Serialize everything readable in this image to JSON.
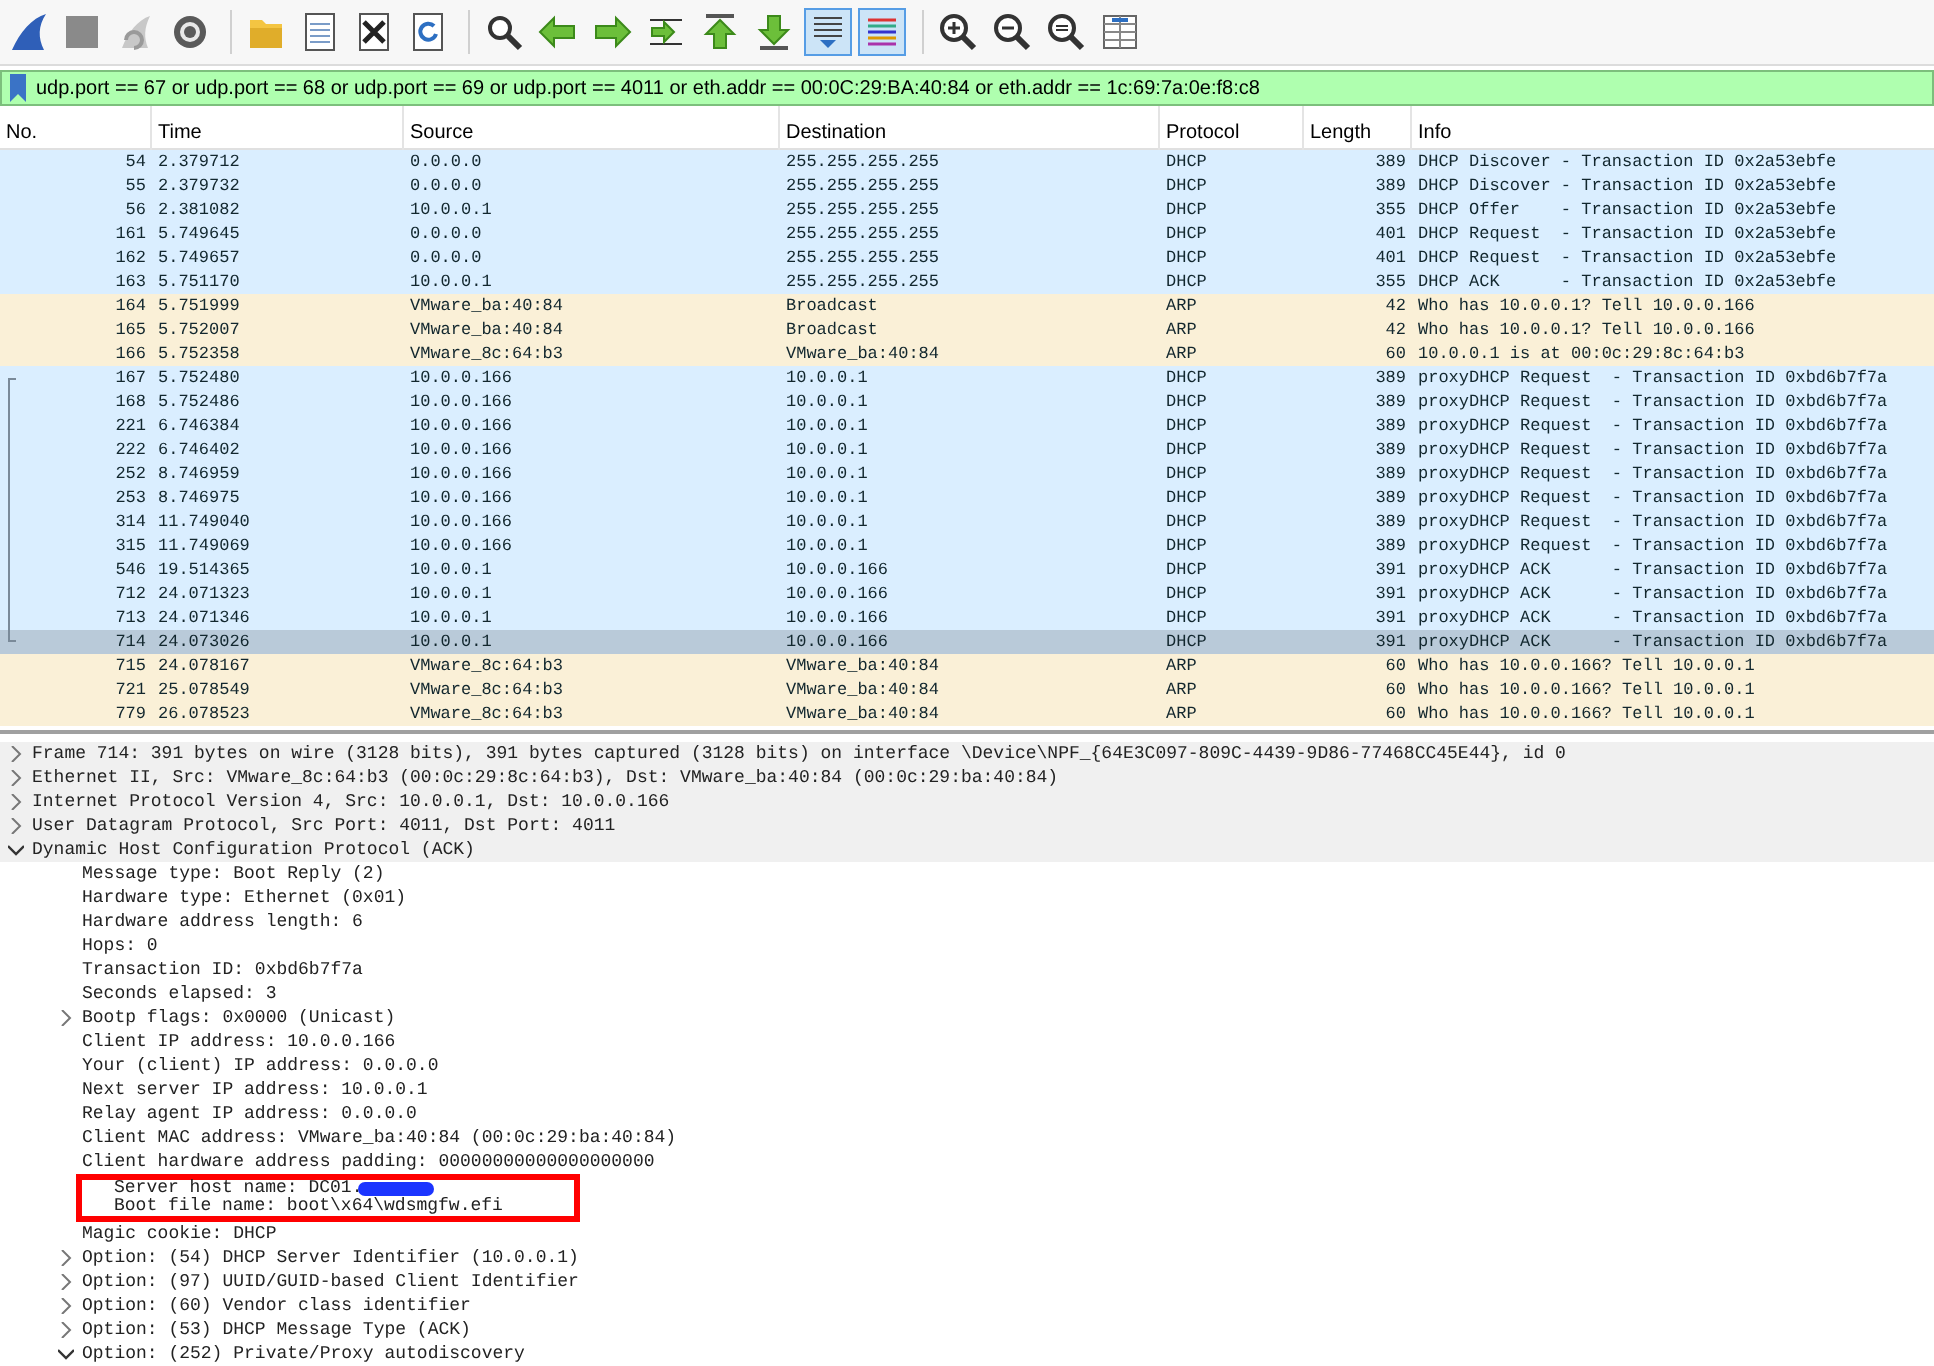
{
  "toolbar": {
    "groups": [
      [
        {
          "kind": "fin",
          "pressed": false
        },
        {
          "kind": "stop",
          "pressed": false
        },
        {
          "kind": "restart",
          "pressed": false
        },
        {
          "kind": "options",
          "pressed": false
        }
      ],
      [
        {
          "kind": "open",
          "pressed": false
        },
        {
          "kind": "file",
          "pressed": false
        },
        {
          "kind": "close",
          "pressed": false
        },
        {
          "kind": "reload",
          "pressed": false
        }
      ],
      [
        {
          "kind": "find",
          "pressed": false
        },
        {
          "kind": "back",
          "pressed": false
        },
        {
          "kind": "forward",
          "pressed": false
        },
        {
          "kind": "goto",
          "pressed": false
        },
        {
          "kind": "first",
          "pressed": false
        },
        {
          "kind": "last",
          "pressed": false
        },
        {
          "kind": "autoscroll",
          "pressed": true
        },
        {
          "kind": "colorize",
          "pressed": true
        }
      ],
      [
        {
          "kind": "zoom-in",
          "pressed": false
        },
        {
          "kind": "zoom-out",
          "pressed": false
        },
        {
          "kind": "zoom-normal",
          "pressed": false
        },
        {
          "kind": "resize",
          "pressed": false
        }
      ]
    ]
  },
  "display_filter": {
    "value": "udp.port == 67 or udp.port == 68 or udp.port == 69 or udp.port == 4011 or eth.addr == 00:0C:29:BA:40:84 or eth.addr == 1c:69:7a:0e:f8:c8"
  },
  "packet_list": {
    "columns": [
      "No.",
      "Time",
      "Source",
      "Destination",
      "Protocol",
      "Length",
      "Info"
    ],
    "rows": [
      {
        "no": "54",
        "time": "2.379712",
        "source": "0.0.0.0",
        "destination": "255.255.255.255",
        "protocol": "DHCP",
        "length": "389",
        "info": "DHCP Discover - Transaction ID 0x2a53ebfe",
        "color": "#daeeff",
        "selected": false,
        "related": false
      },
      {
        "no": "55",
        "time": "2.379732",
        "source": "0.0.0.0",
        "destination": "255.255.255.255",
        "protocol": "DHCP",
        "length": "389",
        "info": "DHCP Discover - Transaction ID 0x2a53ebfe",
        "color": "#daeeff",
        "selected": false,
        "related": false
      },
      {
        "no": "56",
        "time": "2.381082",
        "source": "10.0.0.1",
        "destination": "255.255.255.255",
        "protocol": "DHCP",
        "length": "355",
        "info": "DHCP Offer    - Transaction ID 0x2a53ebfe",
        "color": "#daeeff",
        "selected": false,
        "related": false
      },
      {
        "no": "161",
        "time": "5.749645",
        "source": "0.0.0.0",
        "destination": "255.255.255.255",
        "protocol": "DHCP",
        "length": "401",
        "info": "DHCP Request  - Transaction ID 0x2a53ebfe",
        "color": "#daeeff",
        "selected": false,
        "related": false
      },
      {
        "no": "162",
        "time": "5.749657",
        "source": "0.0.0.0",
        "destination": "255.255.255.255",
        "protocol": "DHCP",
        "length": "401",
        "info": "DHCP Request  - Transaction ID 0x2a53ebfe",
        "color": "#daeeff",
        "selected": false,
        "related": false
      },
      {
        "no": "163",
        "time": "5.751170",
        "source": "10.0.0.1",
        "destination": "255.255.255.255",
        "protocol": "DHCP",
        "length": "355",
        "info": "DHCP ACK      - Transaction ID 0x2a53ebfe",
        "color": "#daeeff",
        "selected": false,
        "related": false
      },
      {
        "no": "164",
        "time": "5.751999",
        "source": "VMware_ba:40:84",
        "destination": "Broadcast",
        "protocol": "ARP",
        "length": "42",
        "info": "Who has 10.0.0.1? Tell 10.0.0.166",
        "color": "#faf0d7",
        "selected": false,
        "related": false
      },
      {
        "no": "165",
        "time": "5.752007",
        "source": "VMware_ba:40:84",
        "destination": "Broadcast",
        "protocol": "ARP",
        "length": "42",
        "info": "Who has 10.0.0.1? Tell 10.0.0.166",
        "color": "#faf0d7",
        "selected": false,
        "related": false
      },
      {
        "no": "166",
        "time": "5.752358",
        "source": "VMware_8c:64:b3",
        "destination": "VMware_ba:40:84",
        "protocol": "ARP",
        "length": "60",
        "info": "10.0.0.1 is at 00:0c:29:8c:64:b3",
        "color": "#faf0d7",
        "selected": false,
        "related": false
      },
      {
        "no": "167",
        "time": "5.752480",
        "source": "10.0.0.166",
        "destination": "10.0.0.1",
        "protocol": "DHCP",
        "length": "389",
        "info": "proxyDHCP Request  - Transaction ID 0xbd6b7f7a",
        "color": "#daeeff",
        "selected": false,
        "related": true
      },
      {
        "no": "168",
        "time": "5.752486",
        "source": "10.0.0.166",
        "destination": "10.0.0.1",
        "protocol": "DHCP",
        "length": "389",
        "info": "proxyDHCP Request  - Transaction ID 0xbd6b7f7a",
        "color": "#daeeff",
        "selected": false,
        "related": true
      },
      {
        "no": "221",
        "time": "6.746384",
        "source": "10.0.0.166",
        "destination": "10.0.0.1",
        "protocol": "DHCP",
        "length": "389",
        "info": "proxyDHCP Request  - Transaction ID 0xbd6b7f7a",
        "color": "#daeeff",
        "selected": false,
        "related": true
      },
      {
        "no": "222",
        "time": "6.746402",
        "source": "10.0.0.166",
        "destination": "10.0.0.1",
        "protocol": "DHCP",
        "length": "389",
        "info": "proxyDHCP Request  - Transaction ID 0xbd6b7f7a",
        "color": "#daeeff",
        "selected": false,
        "related": true
      },
      {
        "no": "252",
        "time": "8.746959",
        "source": "10.0.0.166",
        "destination": "10.0.0.1",
        "protocol": "DHCP",
        "length": "389",
        "info": "proxyDHCP Request  - Transaction ID 0xbd6b7f7a",
        "color": "#daeeff",
        "selected": false,
        "related": true
      },
      {
        "no": "253",
        "time": "8.746975",
        "source": "10.0.0.166",
        "destination": "10.0.0.1",
        "protocol": "DHCP",
        "length": "389",
        "info": "proxyDHCP Request  - Transaction ID 0xbd6b7f7a",
        "color": "#daeeff",
        "selected": false,
        "related": true
      },
      {
        "no": "314",
        "time": "11.749040",
        "source": "10.0.0.166",
        "destination": "10.0.0.1",
        "protocol": "DHCP",
        "length": "389",
        "info": "proxyDHCP Request  - Transaction ID 0xbd6b7f7a",
        "color": "#daeeff",
        "selected": false,
        "related": true
      },
      {
        "no": "315",
        "time": "11.749069",
        "source": "10.0.0.166",
        "destination": "10.0.0.1",
        "protocol": "DHCP",
        "length": "389",
        "info": "proxyDHCP Request  - Transaction ID 0xbd6b7f7a",
        "color": "#daeeff",
        "selected": false,
        "related": true
      },
      {
        "no": "546",
        "time": "19.514365",
        "source": "10.0.0.1",
        "destination": "10.0.0.166",
        "protocol": "DHCP",
        "length": "391",
        "info": "proxyDHCP ACK      - Transaction ID 0xbd6b7f7a",
        "color": "#daeeff",
        "selected": false,
        "related": true
      },
      {
        "no": "712",
        "time": "24.071323",
        "source": "10.0.0.1",
        "destination": "10.0.0.166",
        "protocol": "DHCP",
        "length": "391",
        "info": "proxyDHCP ACK      - Transaction ID 0xbd6b7f7a",
        "color": "#daeeff",
        "selected": false,
        "related": true
      },
      {
        "no": "713",
        "time": "24.071346",
        "source": "10.0.0.1",
        "destination": "10.0.0.166",
        "protocol": "DHCP",
        "length": "391",
        "info": "proxyDHCP ACK      - Transaction ID 0xbd6b7f7a",
        "color": "#daeeff",
        "selected": false,
        "related": true
      },
      {
        "no": "714",
        "time": "24.073026",
        "source": "10.0.0.1",
        "destination": "10.0.0.166",
        "protocol": "DHCP",
        "length": "391",
        "info": "proxyDHCP ACK      - Transaction ID 0xbd6b7f7a",
        "selected": true,
        "related": true
      },
      {
        "no": "715",
        "time": "24.078167",
        "source": "VMware_8c:64:b3",
        "destination": "VMware_ba:40:84",
        "protocol": "ARP",
        "length": "60",
        "info": "Who has 10.0.0.166? Tell 10.0.0.1",
        "color": "#faf0d7",
        "selected": false,
        "related": false
      },
      {
        "no": "721",
        "time": "25.078549",
        "source": "VMware_8c:64:b3",
        "destination": "VMware_ba:40:84",
        "protocol": "ARP",
        "length": "60",
        "info": "Who has 10.0.0.166? Tell 10.0.0.1",
        "color": "#faf0d7",
        "selected": false,
        "related": false
      },
      {
        "no": "779",
        "time": "26.078523",
        "source": "VMware_8c:64:b3",
        "destination": "VMware_ba:40:84",
        "protocol": "ARP",
        "length": "60",
        "info": "Who has 10.0.0.166? Tell 10.0.0.1",
        "color": "#faf0d7",
        "selected": false,
        "related": false
      }
    ]
  },
  "packet_details": [
    {
      "text": "Frame 714: 391 bytes on wire (3128 bits), 391 bytes captured (3128 bits) on interface \\Device\\NPF_{64E3C097-809C-4439-9D86-77468CC45E44}, id 0",
      "expanded": false
    },
    {
      "text": "Ethernet II, Src: VMware_8c:64:b3 (00:0c:29:8c:64:b3), Dst: VMware_ba:40:84 (00:0c:29:ba:40:84)",
      "expanded": false
    },
    {
      "text": "Internet Protocol Version 4, Src: 10.0.0.1, Dst: 10.0.0.166",
      "expanded": false
    },
    {
      "text": "User Datagram Protocol, Src Port: 4011, Dst Port: 4011",
      "expanded": false
    },
    {
      "text": "Dynamic Host Configuration Protocol (ACK)",
      "expanded": true,
      "children": [
        {
          "text": "Message type: Boot Reply (2)"
        },
        {
          "text": "Hardware type: Ethernet (0x01)"
        },
        {
          "text": "Hardware address length: 6"
        },
        {
          "text": "Hops: 0"
        },
        {
          "text": "Transaction ID: 0xbd6b7f7a"
        },
        {
          "text": "Seconds elapsed: 3"
        },
        {
          "text": "Bootp flags: 0x0000 (Unicast)",
          "expanded": false
        },
        {
          "text": "Client IP address: 10.0.0.166"
        },
        {
          "text": "Your (client) IP address: 0.0.0.0"
        },
        {
          "text": "Next server IP address: 10.0.0.1"
        },
        {
          "text": "Relay agent IP address: 0.0.0.0"
        },
        {
          "text": "Client MAC address: VMware_ba:40:84 (00:0c:29:ba:40:84)"
        },
        {
          "text": "Client hardware address padding: 00000000000000000000"
        },
        {
          "text": "Server host name: DC01.",
          "highlighted": true,
          "redacted": true
        },
        {
          "text": "Boot file name: boot\\x64\\wdsmgfw.efi",
          "highlighted": true
        },
        {
          "text": "Magic cookie: DHCP"
        },
        {
          "text": "Option: (54) DHCP Server Identifier (10.0.0.1)",
          "expanded": false
        },
        {
          "text": "Option: (97) UUID/GUID-based Client Identifier",
          "expanded": false
        },
        {
          "text": "Option: (60) Vendor class identifier",
          "expanded": false
        },
        {
          "text": "Option: (53) DHCP Message Type (ACK)",
          "expanded": false
        },
        {
          "text": "Option: (252) Private/Proxy autodiscovery",
          "expanded": true
        }
      ]
    }
  ]
}
